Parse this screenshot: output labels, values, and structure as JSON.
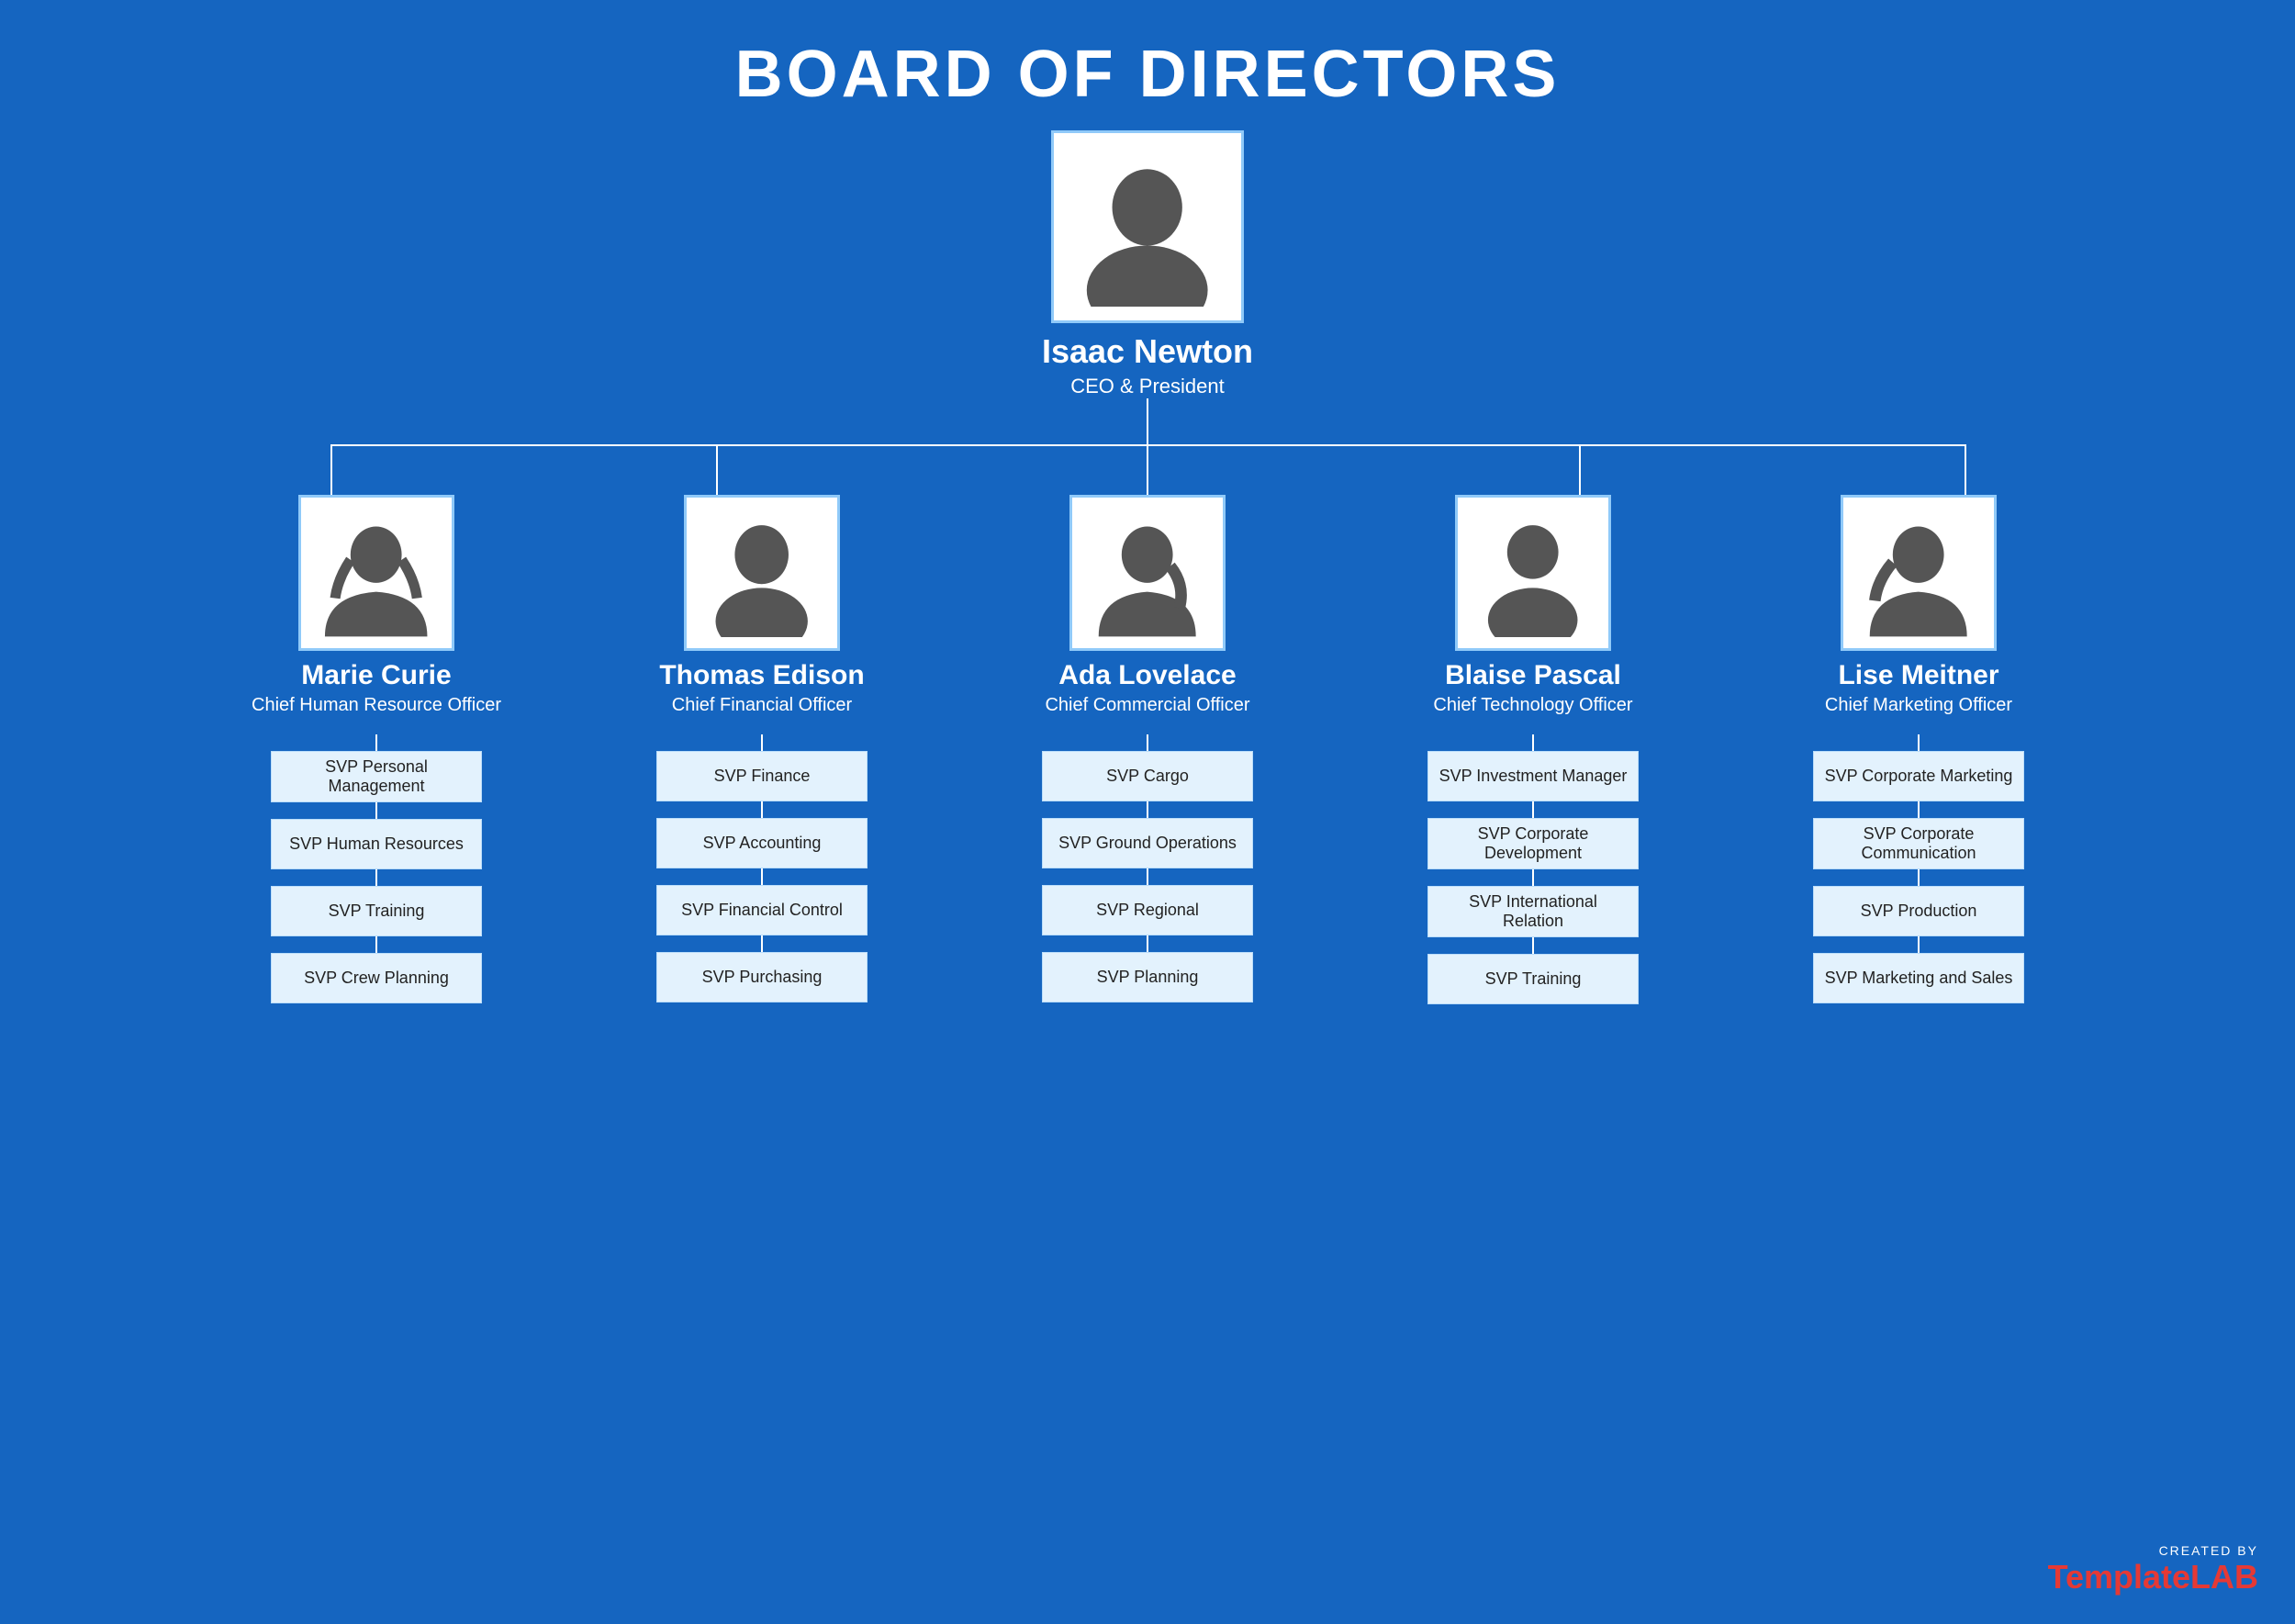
{
  "title": "BOARD OF DIRECTORS",
  "ceo": {
    "name": "Isaac Newton",
    "title": "CEO & President"
  },
  "level2": [
    {
      "name": "Marie Curie",
      "title": "Chief Human Resource Officer",
      "svp": [
        "SVP Personal Management",
        "SVP Human Resources",
        "SVP Training",
        "SVP Crew Planning"
      ]
    },
    {
      "name": "Thomas Edison",
      "title": "Chief Financial Officer",
      "svp": [
        "SVP Finance",
        "SVP Accounting",
        "SVP Financial Control",
        "SVP Purchasing"
      ]
    },
    {
      "name": "Ada Lovelace",
      "title": "Chief Commercial Officer",
      "svp": [
        "SVP Cargo",
        "SVP Ground Operations",
        "SVP Regional",
        "SVP Planning"
      ]
    },
    {
      "name": "Blaise Pascal",
      "title": "Chief Technology Officer",
      "svp": [
        "SVP Investment Manager",
        "SVP Corporate Development",
        "SVP International Relation",
        "SVP Training"
      ]
    },
    {
      "name": "Lise Meitner",
      "title": "Chief Marketing Officer",
      "svp": [
        "SVP Corporate Marketing",
        "SVP Corporate Communication",
        "SVP Production",
        "SVP Marketing and Sales"
      ]
    }
  ],
  "watermark": {
    "created_by": "CREATED BY",
    "brand": "Template",
    "brand_highlight": "LAB"
  }
}
